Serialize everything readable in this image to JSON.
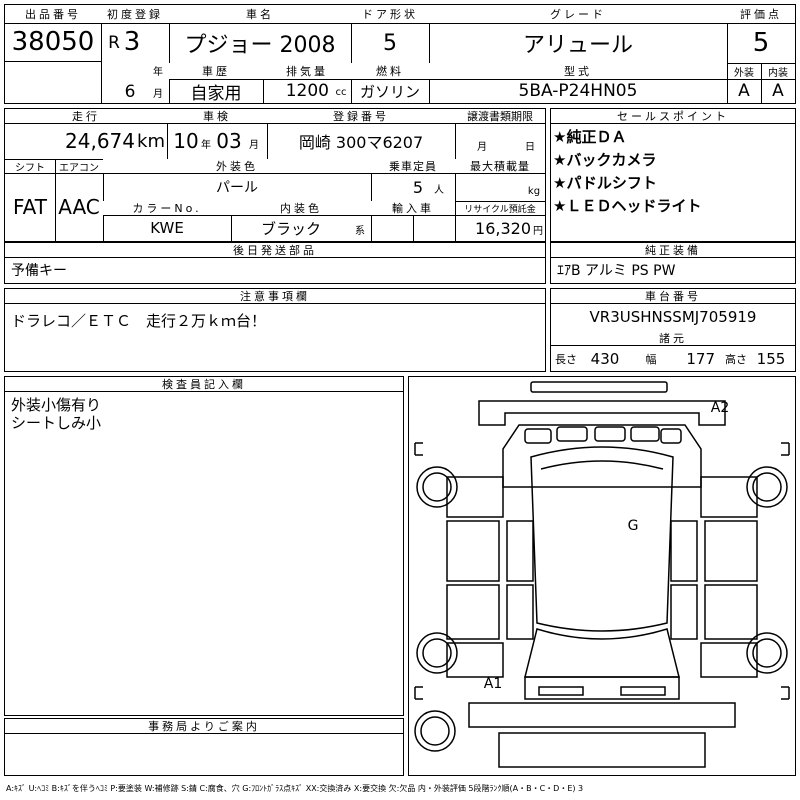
{
  "header": {
    "lot_label": "出品番号",
    "lot_value": "38050",
    "first_reg_label": "初度登録",
    "era": "R",
    "year_value": "3",
    "year_unit": "年",
    "month_value": "6",
    "month_unit": "月",
    "car_name_label": "車名",
    "car_name": "プジョー 2008",
    "door_label": "ドア形状",
    "door_value": "5",
    "grade_label": "グレード",
    "grade_value": "アリュール",
    "score_label": "評価点",
    "score_value": "5",
    "history_label": "車歴",
    "history_value": "自家用",
    "displacement_label": "排気量",
    "displacement_value": "1200",
    "displacement_unit": "cc",
    "fuel_label": "燃料",
    "fuel_value": "ガソリン",
    "model_label": "型式",
    "model_value": "5BA-P24HN05",
    "exterior_label": "外装",
    "exterior_value": "A",
    "interior_label": "内装",
    "interior_value": "A"
  },
  "row2": {
    "mileage_label": "走行",
    "mileage_value": "24,674",
    "mileage_unit": "km",
    "inspection_label": "車検",
    "inspection_year": "10",
    "inspection_year_unit": "年",
    "inspection_month": "03",
    "inspection_month_unit": "月",
    "plate_label": "登録番号",
    "plate_value": "岡崎 300マ6207",
    "transfer_label": "譲渡書類期限",
    "transfer_month_unit": "月",
    "transfer_day_unit": "日",
    "shift_label": "シフト",
    "shift_value": "FAT",
    "ac_label": "エアコン",
    "ac_value": "AAC",
    "color_label": "外装色",
    "color_value": "パール",
    "capacity_label": "乗車定員",
    "capacity_value": "5",
    "capacity_unit": "人",
    "load_label": "最大積載量",
    "load_unit": "kg",
    "color_code_label": "カラーNo.",
    "color_code_value": "KWE",
    "interior_color_label": "内装色",
    "interior_color_value": "ブラック",
    "interior_color_unit": "系",
    "import_label": "輸入車",
    "recycle_label": "リサイクル預託金",
    "recycle_value": "16,320",
    "recycle_unit": "円"
  },
  "sales_points": {
    "label": "セールスポイント",
    "items": [
      "★純正ＤＡ",
      "★バックカメラ",
      "★パドルシフト",
      "★ＬＥＤヘッドライト"
    ]
  },
  "later_parts": {
    "label": "後日発送部品",
    "value": "予備キー"
  },
  "genuine_equipment": {
    "label": "純正装備",
    "value": "ｴｱB アルミ PS PW"
  },
  "notes": {
    "label": "注意事項欄",
    "value": "ドラレコ／ＥＴＣ　走行２万ｋｍ台！"
  },
  "chassis": {
    "label": "車台番号",
    "value": "VR3USHNSSMJ705919",
    "spec_label": "諸元",
    "length_label": "長さ",
    "length_value": "430",
    "width_label": "幅",
    "width_value": "177",
    "height_label": "高さ",
    "height_value": "155"
  },
  "inspector": {
    "label": "検査員記入欄",
    "lines": [
      "外装小傷有り",
      "シートしみ小"
    ]
  },
  "office": {
    "label": "事務局よりご案内"
  },
  "diagram": {
    "marks": [
      "A2",
      "G",
      "A1"
    ]
  },
  "legend": "A:ｷｽﾞ U:ﾍｺﾐ B:ｷｽﾞを伴うﾍｺﾐ P:要塗装 W:補修跡 S:錆 C:腐食、穴 G:ﾌﾛﾝﾄｶﾞﾗｽ点ｷｽﾞ XX:交換済み X:要交換 欠:欠品 内・外装評価 5段階ﾗﾝｸ順(A・B・C・D・E) 3"
}
